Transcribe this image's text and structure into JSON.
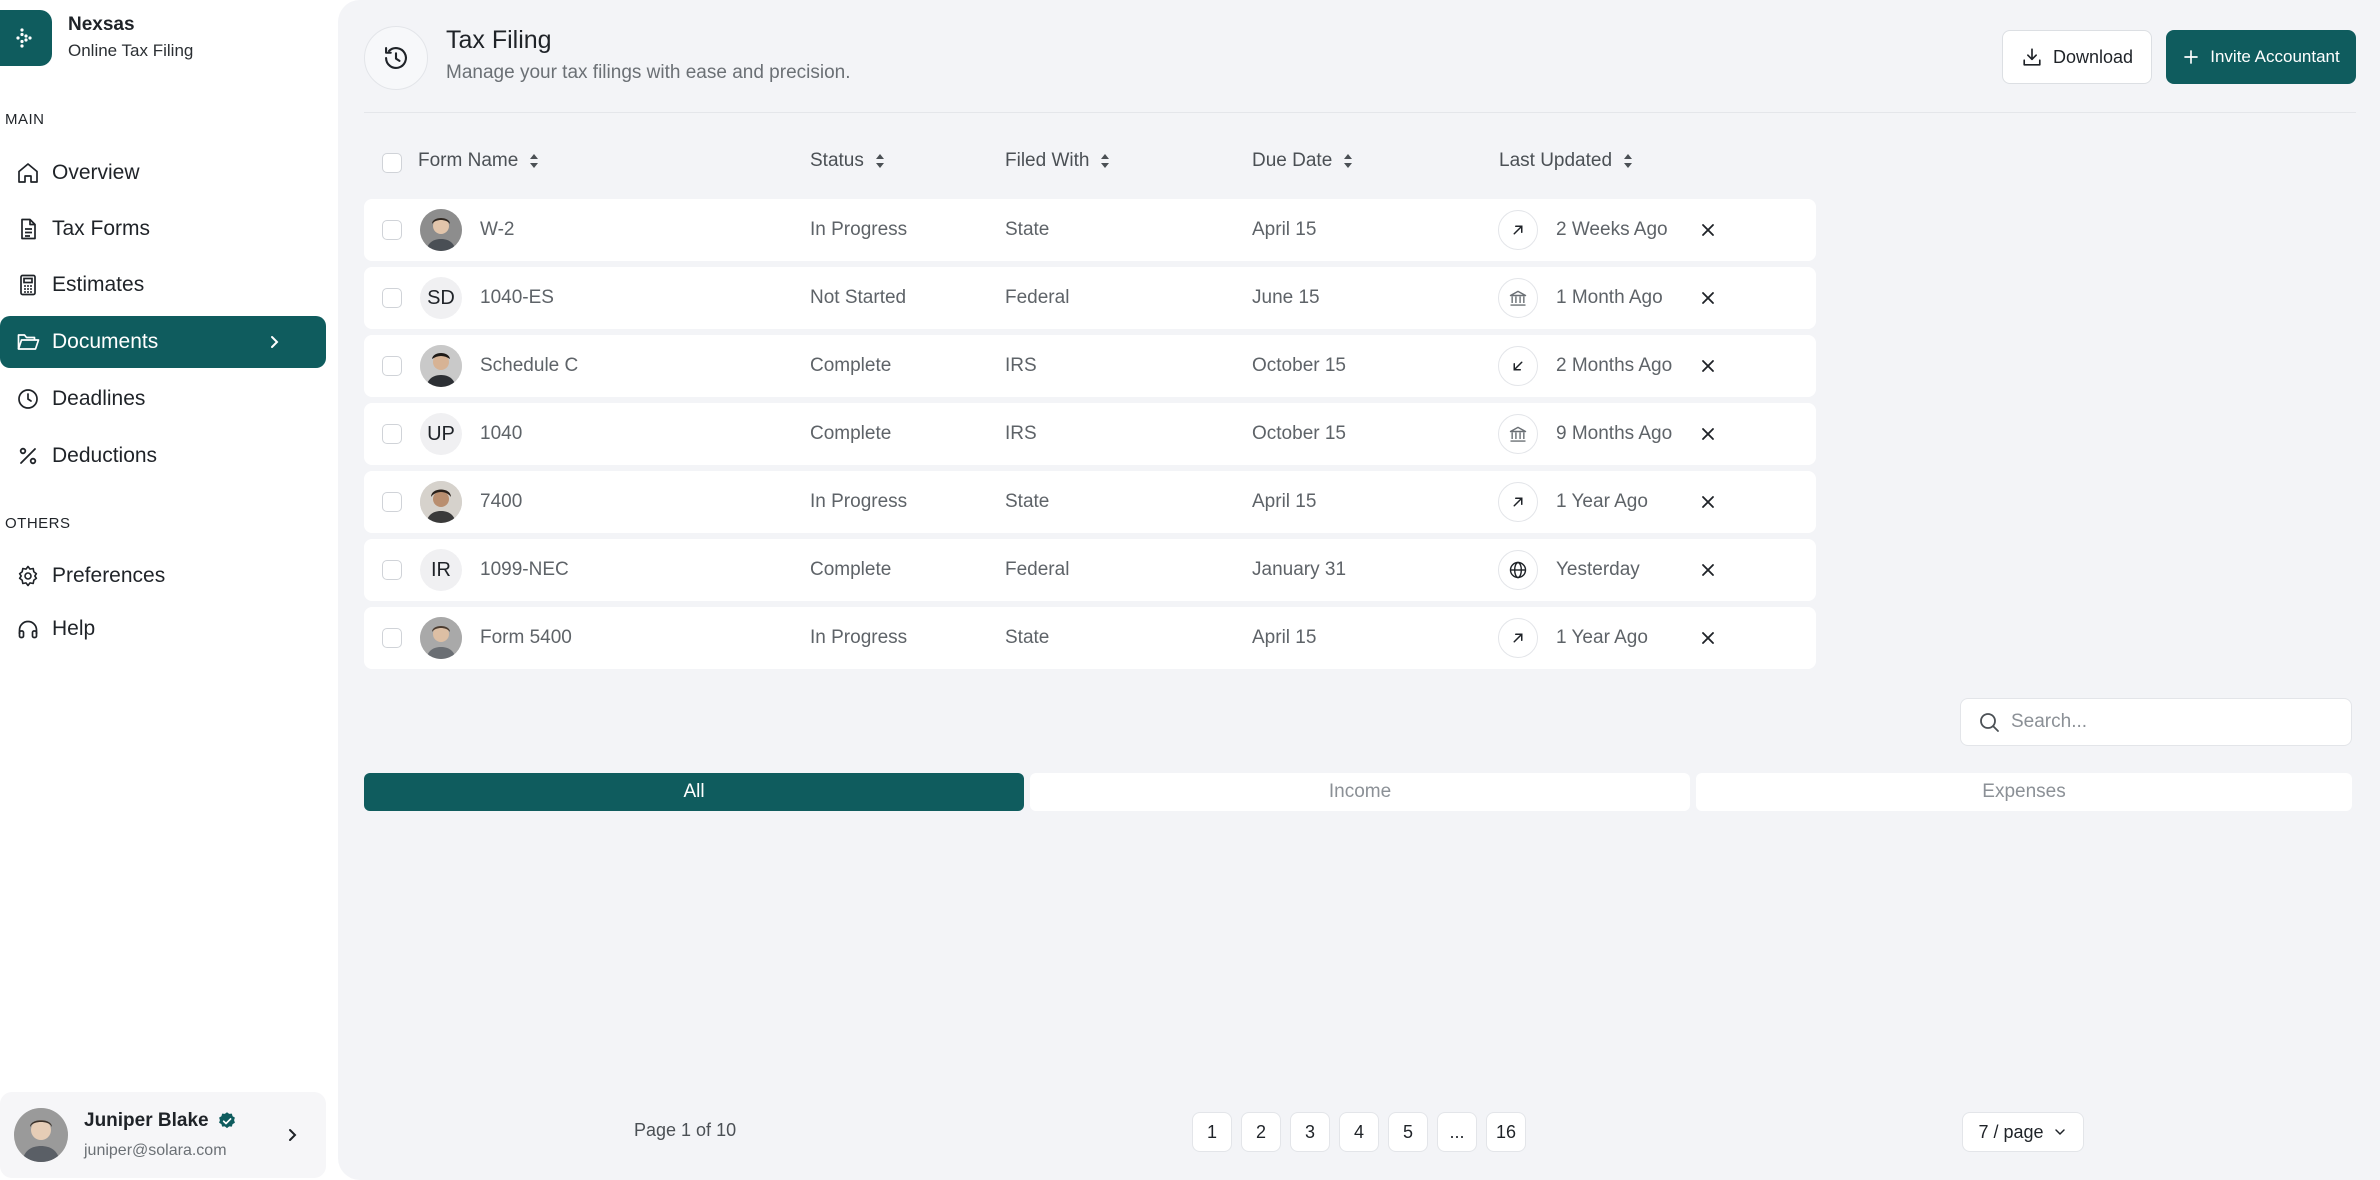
{
  "brand": {
    "name": "Nexsas",
    "subtitle": "Online Tax Filing"
  },
  "sidebar": {
    "main_label": "MAIN",
    "others_label": "OTHERS",
    "main_items": [
      {
        "label": "Overview",
        "icon": "home-icon"
      },
      {
        "label": "Tax Forms",
        "icon": "file-text-icon"
      },
      {
        "label": "Estimates",
        "icon": "calculator-icon"
      },
      {
        "label": "Documents",
        "icon": "folder-open-icon",
        "active": true
      },
      {
        "label": "Deadlines",
        "icon": "clock-icon"
      },
      {
        "label": "Deductions",
        "icon": "percent-icon"
      }
    ],
    "other_items": [
      {
        "label": "Preferences",
        "icon": "gear-icon"
      },
      {
        "label": "Help",
        "icon": "headphones-icon"
      }
    ]
  },
  "user": {
    "name": "Juniper Blake",
    "email": "juniper@solara.com",
    "verified": true
  },
  "header": {
    "title": "Tax Filing",
    "subtitle": "Manage your tax filings with ease and precision.",
    "download_label": "Download",
    "invite_label": "Invite Accountant"
  },
  "table": {
    "columns": [
      "Form Name",
      "Status",
      "Filed With",
      "Due Date",
      "Last Updated"
    ],
    "rows": [
      {
        "avatar": "photo",
        "form": "W-2",
        "status": "In Progress",
        "filed_with": "State",
        "due": "April 15",
        "updated_icon": "arrow-up-right-icon",
        "updated": "2 Weeks Ago"
      },
      {
        "avatar": "SD",
        "form": "1040-ES",
        "status": "Not Started",
        "filed_with": "Federal",
        "due": "June 15",
        "updated_icon": "bank-icon",
        "updated": "1 Month Ago"
      },
      {
        "avatar": "photo",
        "form": "Schedule C",
        "status": "Complete",
        "filed_with": "IRS",
        "due": "October 15",
        "updated_icon": "arrow-down-left-icon",
        "updated": "2 Months Ago"
      },
      {
        "avatar": "UP",
        "form": "1040",
        "status": "Complete",
        "filed_with": "IRS",
        "due": "October 15",
        "updated_icon": "bank-icon",
        "updated": "9 Months Ago"
      },
      {
        "avatar": "photo",
        "form": "7400",
        "status": "In Progress",
        "filed_with": "State",
        "due": "April 15",
        "updated_icon": "arrow-up-right-icon",
        "updated": "1 Year Ago"
      },
      {
        "avatar": "IR",
        "form": "1099-NEC",
        "status": "Complete",
        "filed_with": "Federal",
        "due": "January 31",
        "updated_icon": "globe-icon",
        "updated": "Yesterday"
      },
      {
        "avatar": "photo",
        "form": "Form 5400",
        "status": "In Progress",
        "filed_with": "State",
        "due": "April 15",
        "updated_icon": "arrow-up-right-icon",
        "updated": "1 Year Ago"
      }
    ]
  },
  "search": {
    "placeholder": "Search..."
  },
  "tabs": [
    {
      "label": "All",
      "active": true
    },
    {
      "label": "Income"
    },
    {
      "label": "Expenses"
    }
  ],
  "pagination": {
    "info": "Page 1 of 10",
    "pages": [
      "1",
      "2",
      "3",
      "4",
      "5",
      "...",
      "16"
    ],
    "per_page": "7 / page"
  },
  "colors": {
    "accent": "#0f5c5e",
    "background": "#f3f4f7"
  }
}
